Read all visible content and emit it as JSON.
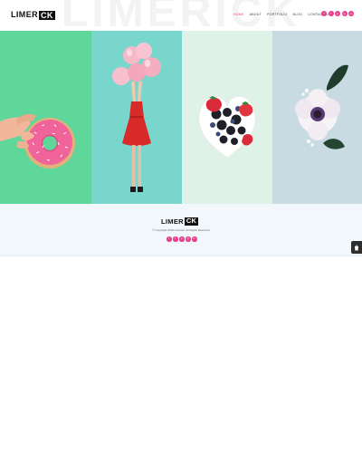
{
  "header": {
    "background_word": "LIMERICK",
    "logo": {
      "plain": "LIMER",
      "boxed": "CK"
    },
    "nav": [
      {
        "label": "HOME",
        "active": true
      },
      {
        "label": "ABOUT",
        "active": false
      },
      {
        "label": "PORTFOLIO",
        "active": false
      },
      {
        "label": "BLOG",
        "active": false
      },
      {
        "label": "CONTACT US",
        "active": false
      }
    ],
    "social_icons": [
      "facebook-icon",
      "twitter-icon",
      "pinterest-icon",
      "instagram-icon",
      "linkedin-icon"
    ]
  },
  "gallery": {
    "tiles": [
      {
        "subject": "donut",
        "background": "#5fd79a"
      },
      {
        "subject": "balloons",
        "background": "#79d6cc"
      },
      {
        "subject": "berries",
        "background": "#dff2e8"
      },
      {
        "subject": "flower",
        "background": "#c8dbe3"
      }
    ]
  },
  "footer": {
    "logo": {
      "plain": "LIMER",
      "boxed": "CK"
    },
    "copyright": "© Copyright 2018 Limerick. All Rights Reserved",
    "social_icons": [
      "facebook-icon",
      "twitter-icon",
      "pinterest-icon",
      "instagram-icon",
      "linkedin-icon"
    ]
  },
  "colors": {
    "accent": "#e83e8c",
    "footer_bg": "#f2f7fb",
    "float_button": "#2e2e2e"
  },
  "floating_button": {
    "icon": "cart-icon"
  }
}
